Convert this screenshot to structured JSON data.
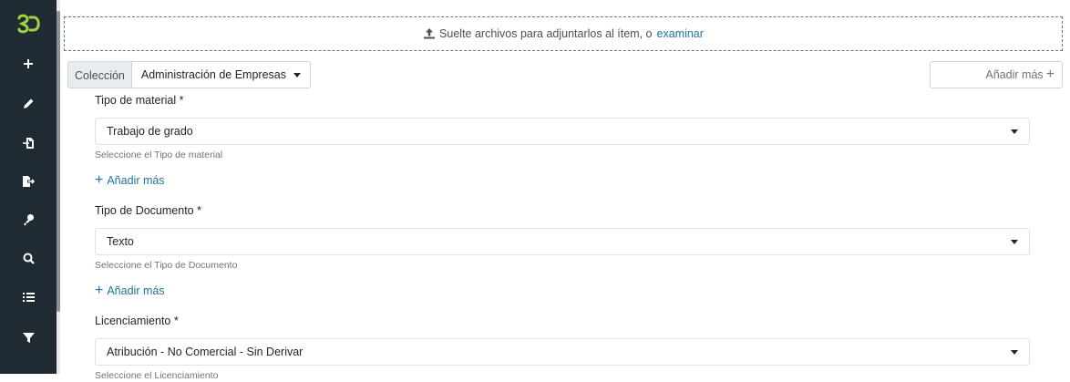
{
  "sidebar": {
    "colors": {
      "background": "#1f2a33",
      "logo": "#9ed23e",
      "icon": "#ffffff"
    },
    "icons": [
      "logo-icon",
      "plus-icon",
      "pencil-icon",
      "import-icon",
      "export-icon",
      "key-icon",
      "search-icon",
      "list-icon",
      "filter-icon"
    ]
  },
  "dropzone": {
    "text": "Suelte archivos para adjuntarlos al ítem, o",
    "link": "examinar"
  },
  "collection": {
    "label": "Colección",
    "value": "Administración de Empresas"
  },
  "add_more_top": {
    "label": "Añadir más"
  },
  "fields": [
    {
      "label": "Tipo de material *",
      "value": "Trabajo de grado",
      "help": "Seleccione el Tipo de material",
      "add_more": "Añadir más"
    },
    {
      "label": "Tipo de Documento *",
      "value": "Texto",
      "help": "Seleccione el Tipo de Documento",
      "add_more": "Añadir más"
    },
    {
      "label": "Licenciamiento *",
      "value": "Atribución - No Comercial - Sin Derivar",
      "help": "Seleccione el Licenciamiento"
    }
  ],
  "colors": {
    "link": "#207698",
    "muted": "#6c757d",
    "border": "#ced4da"
  }
}
